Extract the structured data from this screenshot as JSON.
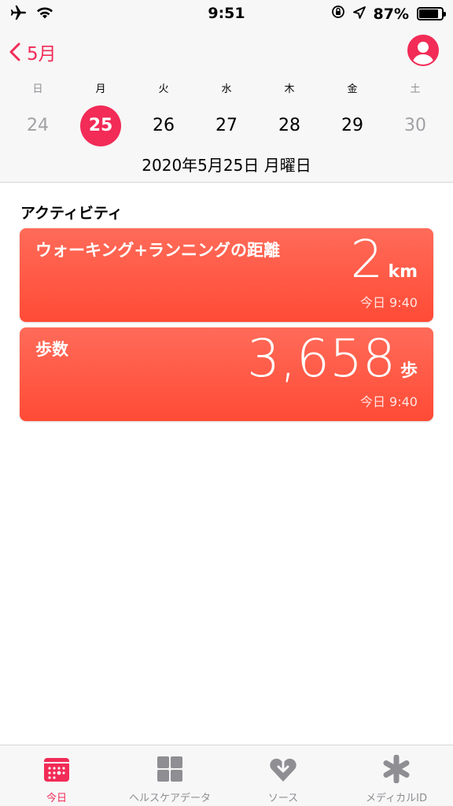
{
  "status_bar": {
    "time": "9:51",
    "battery": "87%",
    "battery_level": 0.87,
    "icons": [
      "airplane-icon",
      "wifi-icon",
      "orientation-lock-icon",
      "location-icon",
      "battery-icon"
    ]
  },
  "nav": {
    "back_label": "5月",
    "profile_icon": "profile-icon"
  },
  "week": {
    "days": [
      "日",
      "月",
      "火",
      "水",
      "木",
      "金",
      "土"
    ],
    "dates": [
      "24",
      "25",
      "26",
      "27",
      "28",
      "29",
      "30"
    ],
    "selected_index": 1
  },
  "full_date": "2020年5月25日 月曜日",
  "section_title": "アクティビティ",
  "cards": [
    {
      "title": "ウォーキング+ランニングの距離",
      "value": "2",
      "unit": "km",
      "time": "今日 9:40"
    },
    {
      "title": "歩数",
      "value": "3,658",
      "unit": "歩",
      "time": "今日 9:40"
    }
  ],
  "tabs": [
    {
      "label": "今日",
      "icon": "today-icon",
      "active": true
    },
    {
      "label": "ヘルスケアデータ",
      "icon": "grid-icon",
      "active": false
    },
    {
      "label": "ソース",
      "icon": "heart-download-icon",
      "active": false
    },
    {
      "label": "メディカルID",
      "icon": "asterisk-icon",
      "active": false
    }
  ],
  "colors": {
    "accent": "#f22b57",
    "card": "#ff5a45",
    "inactive": "#8e8e93"
  }
}
